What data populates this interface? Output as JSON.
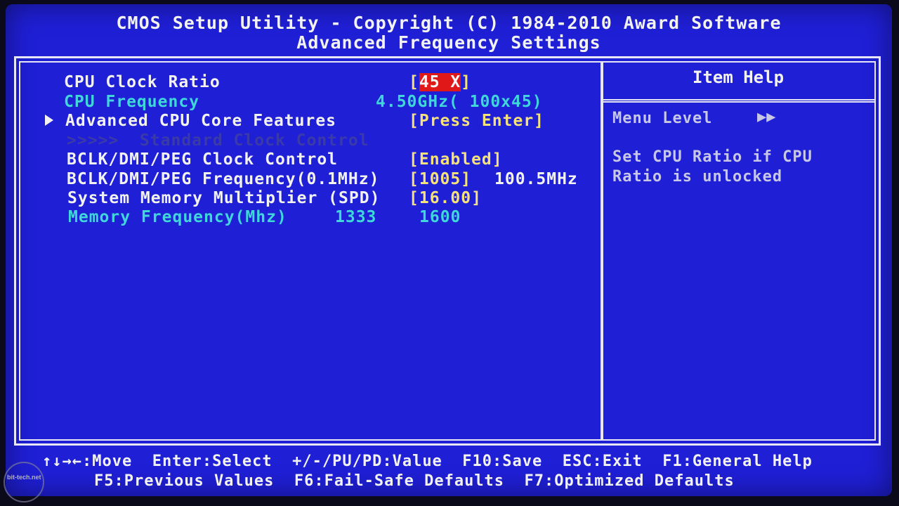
{
  "header": {
    "title": "CMOS Setup Utility - Copyright (C) 1984-2010 Award Software",
    "subtitle": "Advanced Frequency Settings"
  },
  "settings": [
    {
      "label": "CPU Clock Ratio",
      "bracket_open": "[",
      "value": "45 X",
      "bracket_close": "]"
    },
    {
      "label": "CPU Frequency",
      "value": "4.50GHz( 100x45)"
    },
    {
      "label": "Advanced CPU Core Features",
      "value": "[Press Enter]"
    },
    {
      "label": ">>>>>  Standard Clock Control"
    },
    {
      "label": "BCLK/DMI/PEG Clock Control",
      "value": "[Enabled]"
    },
    {
      "label": "BCLK/DMI/PEG Frequency(0.1MHz)",
      "value": "[1005]",
      "extra": "100.5MHz"
    },
    {
      "label": "System Memory Multiplier (SPD)",
      "value": "[16.00]"
    },
    {
      "label": "Memory Frequency(Mhz)",
      "value": "1333",
      "extra": "1600"
    }
  ],
  "help": {
    "title": "Item Help",
    "menu_level_label": "Menu Level",
    "menu_level_arrows": "▶▶",
    "text_line1": "Set CPU Ratio if CPU",
    "text_line2": "Ratio is unlocked"
  },
  "footer": {
    "line1": "↑↓→←:Move  Enter:Select  +/-/PU/PD:Value  F10:Save  ESC:Exit  F1:General Help",
    "line2": "F5:Previous Values  F6:Fail-Safe Defaults  F7:Optimized Defaults"
  },
  "watermark": {
    "text": "bit-tech.net"
  },
  "colors": {
    "background": "#1f1fd6",
    "label_white": "#f2f2f2",
    "label_cyan": "#3fd7d9",
    "value_yellow": "#f5e27a",
    "selection_red": "#e01818"
  }
}
